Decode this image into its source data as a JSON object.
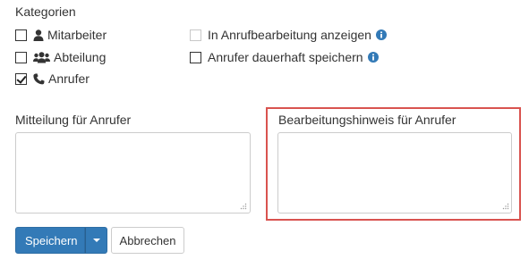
{
  "categories": {
    "title": "Kategorien",
    "items": [
      {
        "label": "Mitarbeiter",
        "checked": false,
        "icon": "user-icon"
      },
      {
        "label": "Abteilung",
        "checked": false,
        "icon": "users-icon"
      },
      {
        "label": "Anrufer",
        "checked": true,
        "icon": "phone-icon"
      }
    ]
  },
  "options": [
    {
      "label": "In Anrufbearbeitung anzeigen",
      "checked": false,
      "disabled": true,
      "icon": "info-icon"
    },
    {
      "label": "Anrufer dauerhaft speichern",
      "checked": false,
      "disabled": false,
      "icon": "info-icon"
    }
  ],
  "message_field": {
    "label": "Mitteilung für Anrufer",
    "value": ""
  },
  "note_field": {
    "label": "Bearbeitungshinweis für Anrufer",
    "value": ""
  },
  "actions": {
    "save_label": "Speichern",
    "cancel_label": "Abbrechen"
  },
  "colors": {
    "primary": "#337ab7",
    "highlight": "#d9534f",
    "info": "#337ab7"
  }
}
